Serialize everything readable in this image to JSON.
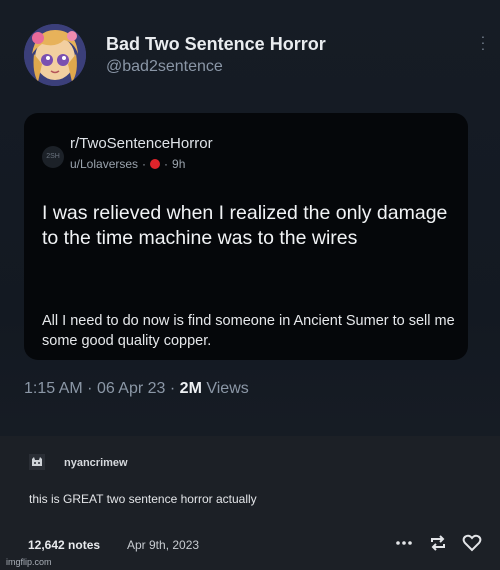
{
  "tweet": {
    "author_name": "Bad Two Sentence Horror",
    "author_handle": "@bad2sentence",
    "time": "1:15 AM",
    "date": "06 Apr 23",
    "views_count": "2M",
    "views_label": "Views",
    "icons": {
      "avatar": "anime-girl-avatar",
      "more": "vertical-dots-icon"
    }
  },
  "reddit": {
    "subreddit": "r/TwoSentenceHorror",
    "sub_icon_text": "2SH",
    "user": "u/Lolaverses",
    "age": "9h",
    "title": "I was relieved when I realized the only damage to the time machine was to the wires",
    "body": "All I need to do now is find someone in Ancient Sumer to sell me some good quality copper."
  },
  "tumblr": {
    "reblogger": "nyancrimew",
    "comment": "this is GREAT two sentence horror actually",
    "notes": "12,642 notes",
    "date": "Apr 9th, 2023"
  },
  "watermark": "imgflip.com"
}
